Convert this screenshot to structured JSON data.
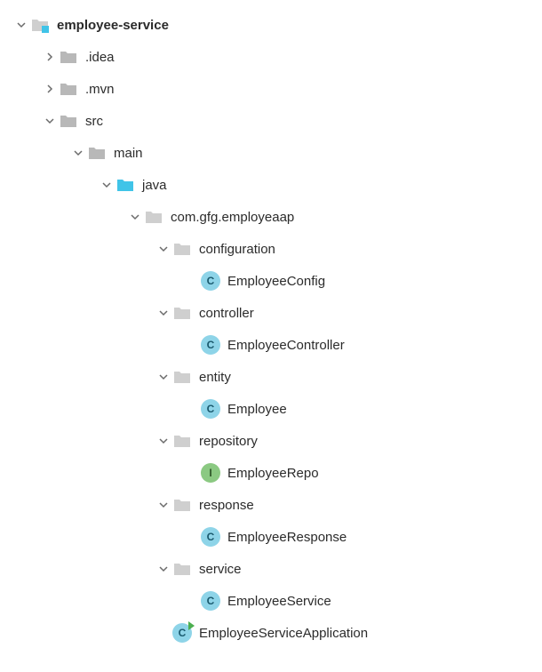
{
  "tree": {
    "root": "employee-service",
    "idea": ".idea",
    "mvn": ".mvn",
    "src": "src",
    "main": "main",
    "java": "java",
    "package": "com.gfg.employeaap",
    "configuration": "configuration",
    "employeeConfig": "EmployeeConfig",
    "controller": "controller",
    "employeeController": "EmployeeController",
    "entity": "entity",
    "employee": "Employee",
    "repository": "repository",
    "employeeRepo": "EmployeeRepo",
    "response": "response",
    "employeeResponse": "EmployeeResponse",
    "service": "service",
    "employeeService": "EmployeeService",
    "application": "EmployeeServiceApplication"
  },
  "icons": {
    "class_letter": "C",
    "interface_letter": "I"
  },
  "colors": {
    "folder_gray": "#b8b8b8",
    "folder_blue": "#40c4e8",
    "folder_gray_light": "#cfcfcf",
    "arrow": "#6b6b6b"
  }
}
